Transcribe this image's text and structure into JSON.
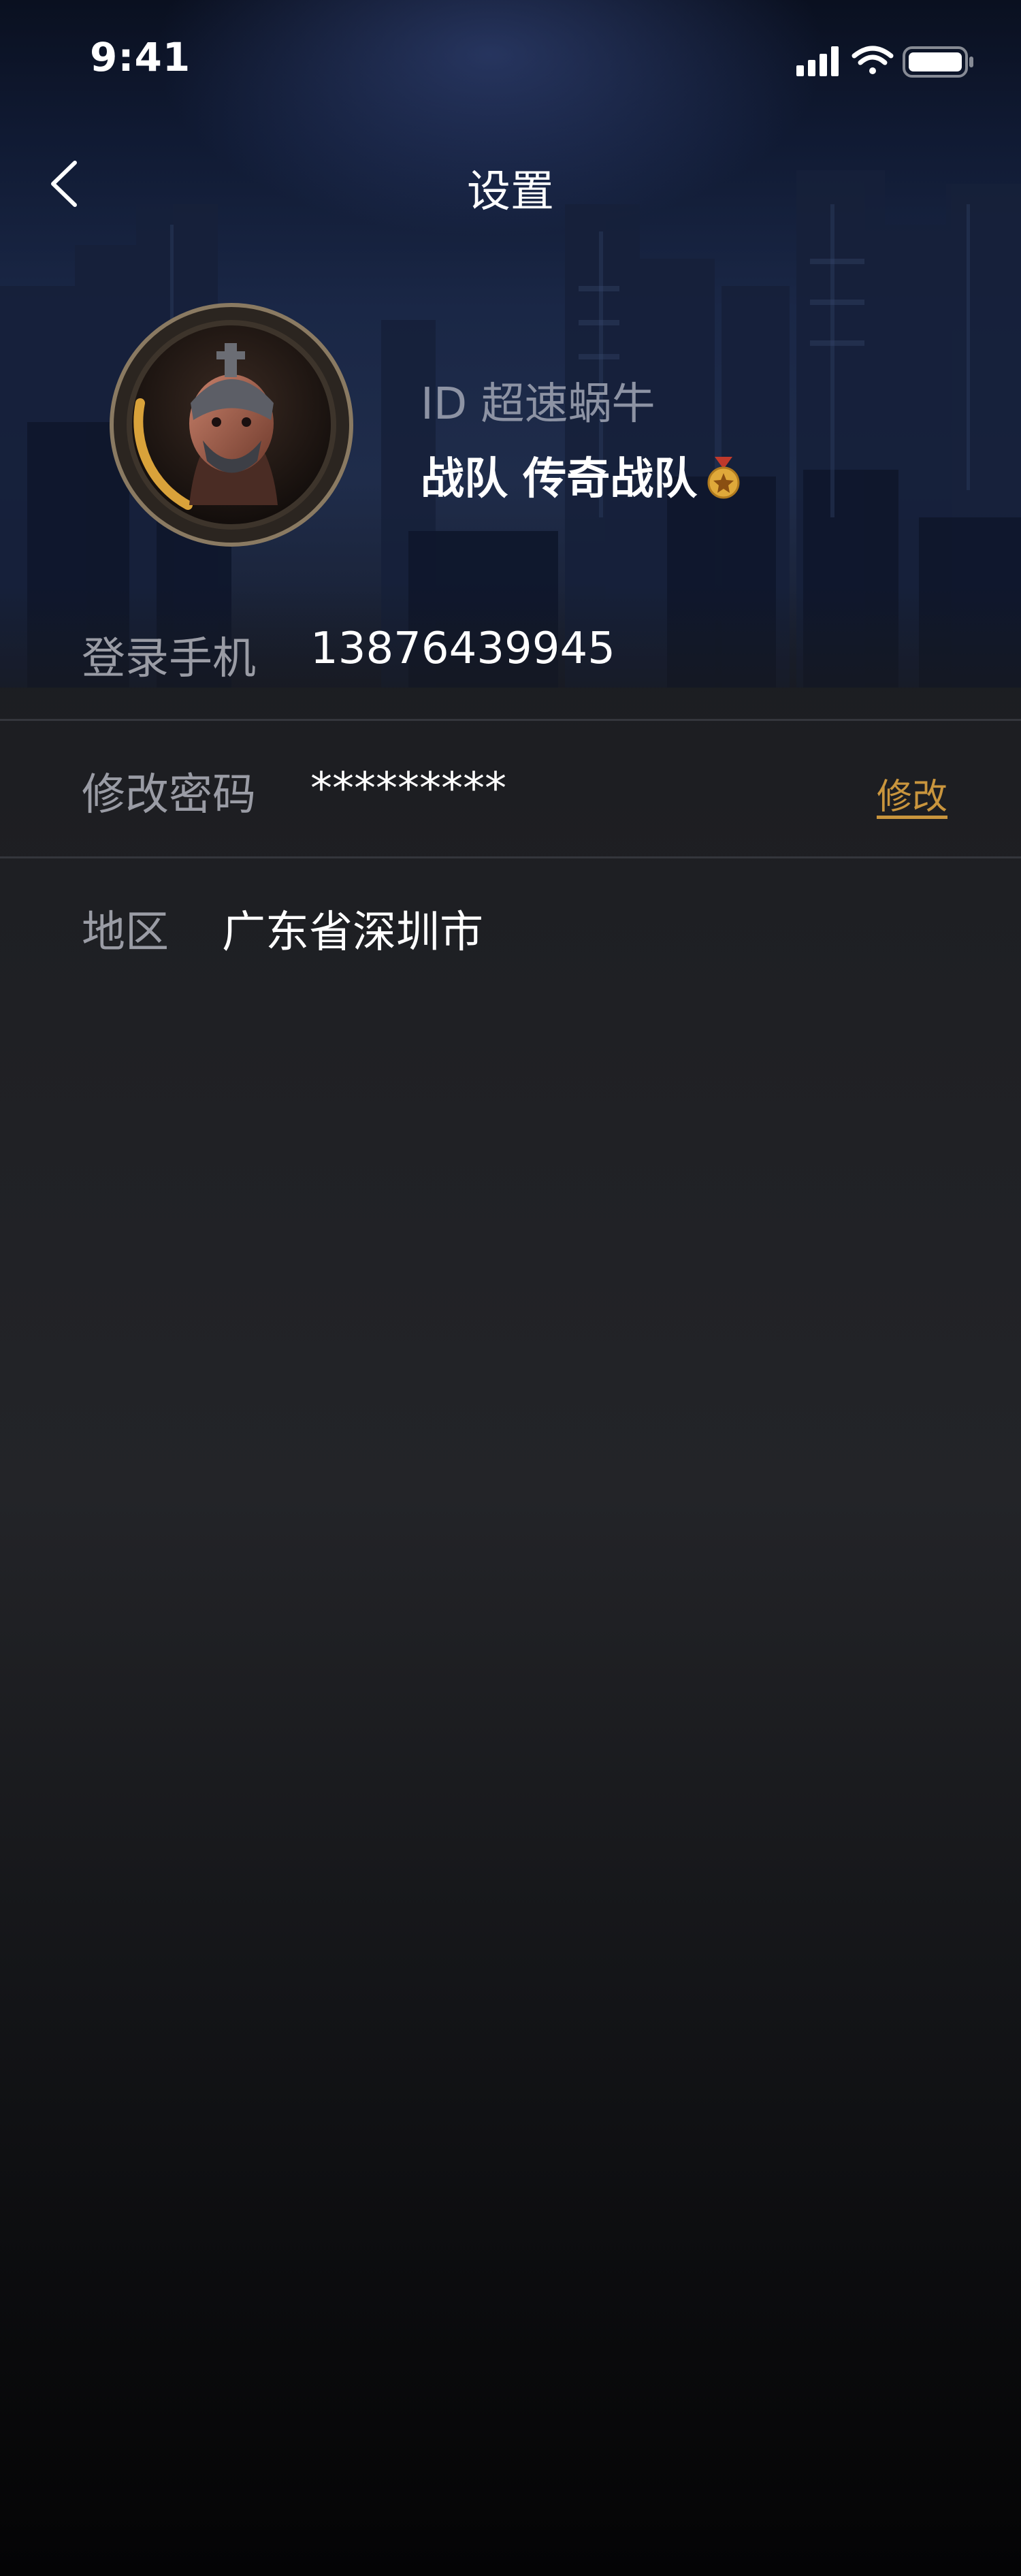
{
  "status_bar": {
    "time": "9:41",
    "icons": [
      "cellular-signal-icon",
      "wifi-icon",
      "battery-icon"
    ]
  },
  "nav": {
    "back_icon": "chevron-left-icon",
    "title": "设置"
  },
  "profile": {
    "id_text": "ID 超速蜗牛",
    "team_text": "战队 传奇战队",
    "team_badge_icon": "medal-icon",
    "avatar_ring_color": "#d9a23a"
  },
  "settings": {
    "phone": {
      "label": "登录手机",
      "value": "13876439945"
    },
    "password": {
      "label": "修改密码",
      "value": "*********",
      "action": "修改"
    },
    "region": {
      "label": "地区",
      "value": "广东省深圳市"
    }
  },
  "colors": {
    "accent": "#c9953d",
    "label": "#9a9ca5",
    "divider": "#34363c"
  }
}
